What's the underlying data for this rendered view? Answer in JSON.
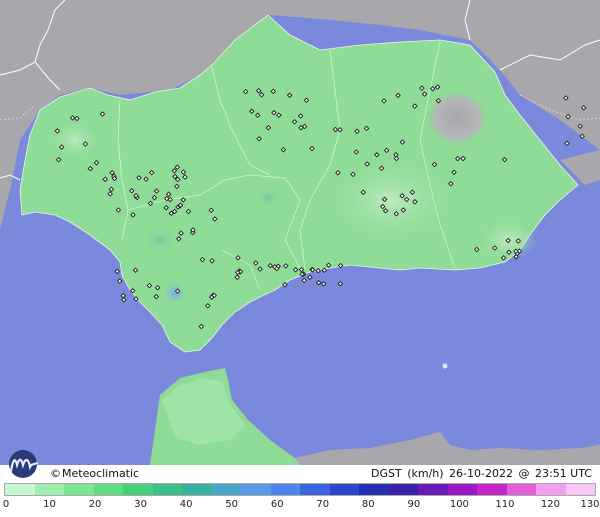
{
  "brand": {
    "copyright_symbol": "©",
    "name": "Meteoclimatic"
  },
  "caption": {
    "variable": "DGST",
    "unit": "(km/h)",
    "date": "26-10-2022",
    "at": "@",
    "time": "23:51 UTC"
  },
  "legend": {
    "ticks": [
      "0",
      "10",
      "20",
      "30",
      "40",
      "50",
      "60",
      "70",
      "80",
      "90",
      "100",
      "110",
      "120",
      "130"
    ],
    "tick_values": [
      0,
      10,
      20,
      30,
      40,
      50,
      60,
      70,
      80,
      90,
      100,
      110,
      120,
      130
    ],
    "max_value": 130,
    "colors": [
      "#c8f5d2",
      "#9eeeb0",
      "#7de694",
      "#5fdb84",
      "#46cf7a",
      "#3dbf8a",
      "#3ab09e",
      "#47a8c8",
      "#5a9ae6",
      "#4f86ee",
      "#3b64dc",
      "#2b46c8",
      "#2430b0",
      "#3a22a8",
      "#6a1ab8",
      "#9a18c6",
      "#c424c8",
      "#e060d8",
      "#f0a0ec",
      "#f8c8f4"
    ]
  },
  "colors": {
    "sea": "#7b89dc",
    "land_outside": "#a8a8ac",
    "region": "#8fdc96",
    "region_light": "#a6e6ac",
    "border": "#ffffff",
    "station": "#1a1a1a"
  },
  "stations_count": 170
}
